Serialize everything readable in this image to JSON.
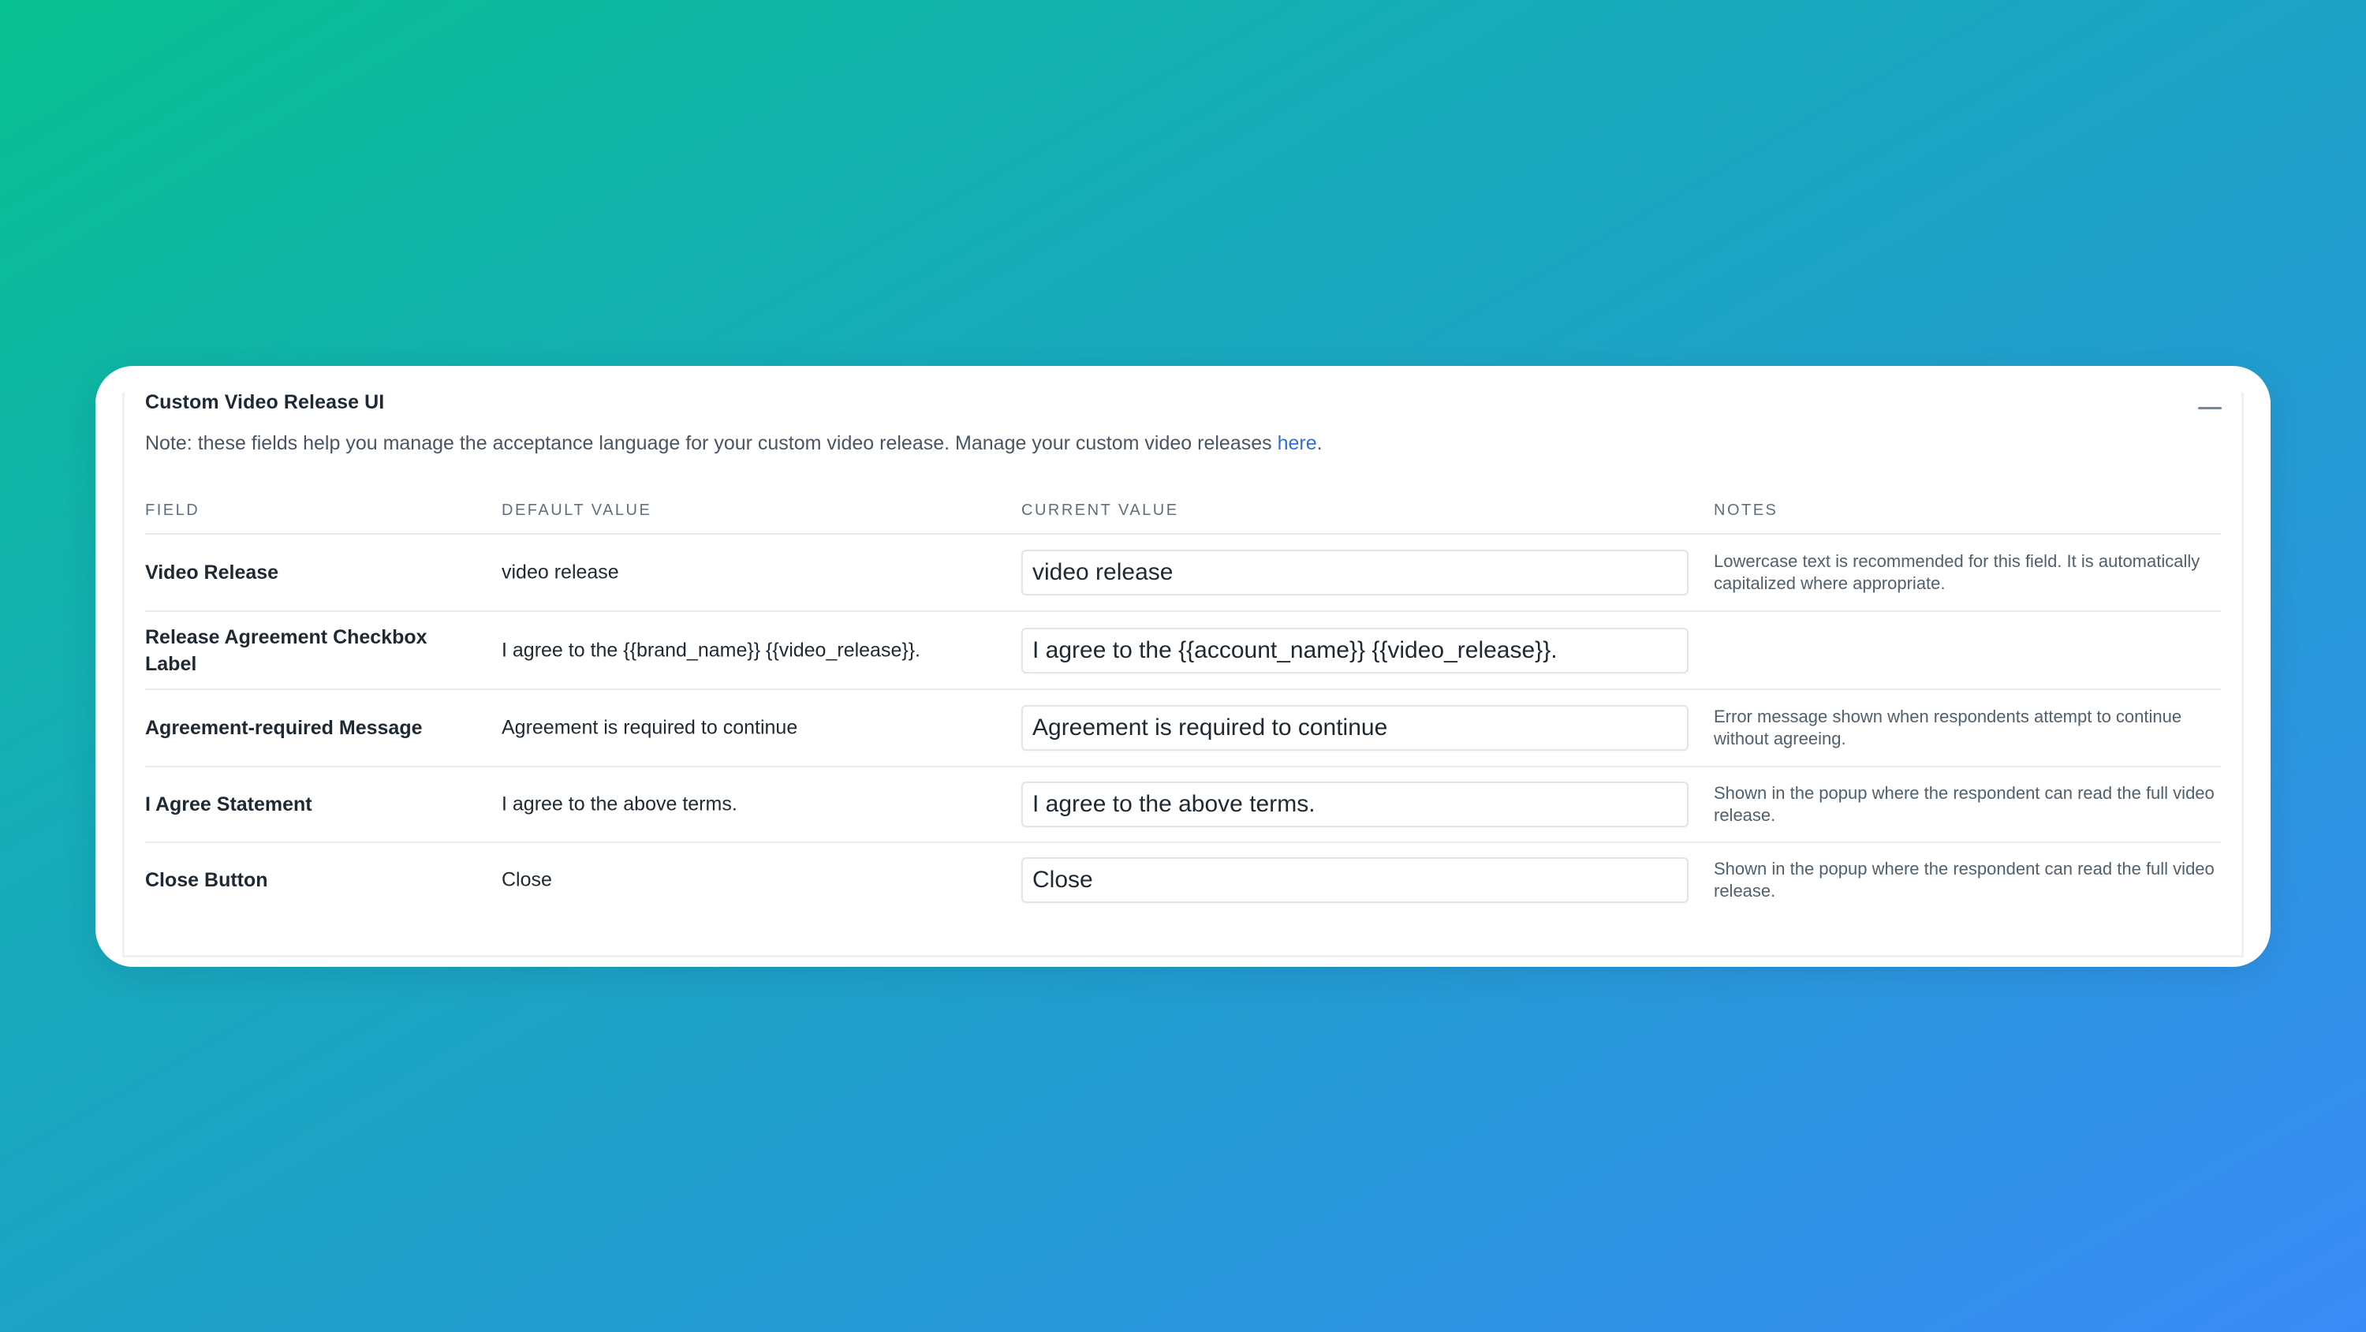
{
  "card": {
    "title": "Custom Video Release UI",
    "note_prefix": "Note: these fields help you manage the acceptance language for your custom video release. Manage your custom video releases ",
    "note_link": "here",
    "note_suffix": "."
  },
  "table": {
    "headers": {
      "field": "FIELD",
      "default": "DEFAULT VALUE",
      "current": "CURRENT VALUE",
      "notes": "NOTES"
    },
    "rows": [
      {
        "field": "Video Release",
        "default": "video release",
        "current": "video release",
        "notes": "Lowercase text is recommended for this field. It is automatically capitalized where appropriate."
      },
      {
        "field": "Release Agreement Checkbox Label",
        "default": "I agree to the {{brand_name}} {{video_release}}.",
        "current": "I agree to the {{account_name}} {{video_release}}.",
        "notes": ""
      },
      {
        "field": "Agreement-required Message",
        "default": "Agreement is required to continue",
        "current": "Agreement is required to continue",
        "notes": "Error message shown when respondents attempt to continue without agreeing."
      },
      {
        "field": "I Agree Statement",
        "default": "I agree to the above terms.",
        "current": "I agree to the above terms.",
        "notes": "Shown in the popup where the respondent can read the full video release."
      },
      {
        "field": "Close Button",
        "default": "Close",
        "current": "Close",
        "notes": "Shown in the popup where the respondent can read the full video release."
      }
    ]
  },
  "colors": {
    "background_start": "#07c08f",
    "background_end": "#3b8bf7",
    "link": "#2f6fe0",
    "card": "#ffffff"
  },
  "icons": {
    "collapse": "minus-icon"
  }
}
